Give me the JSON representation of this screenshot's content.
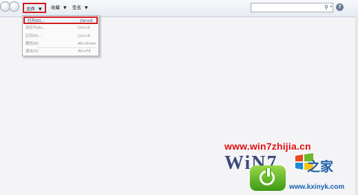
{
  "toolbar": {
    "file_label": "文件",
    "favorites_label": "收藏",
    "bookmarks_label": "签名",
    "caret": "▼",
    "search_icon": "⚲",
    "search_caret": "▾",
    "help_icon": "?"
  },
  "file_menu": {
    "items": [
      {
        "label": "打开(O)...",
        "shortcut": "Ctrl+O"
      },
      {
        "label": "另存为(A)...",
        "shortcut": "Ctrl+S"
      },
      {
        "label": "打印(P)...",
        "shortcut": "Ctrl+P"
      },
      {
        "label": "属性(R)",
        "shortcut": "Alt+Enter"
      },
      {
        "label": "退出(X)",
        "shortcut": "Alt+F4"
      }
    ]
  },
  "watermark": {
    "url": "www.win7zhijia.cn",
    "logo": "WiN7",
    "chinese": "之家",
    "domain": "www.kxinyk.com"
  },
  "colors": {
    "highlight": "#d01818",
    "watermark_red": "#e01010",
    "badge_green": "#58b120"
  }
}
